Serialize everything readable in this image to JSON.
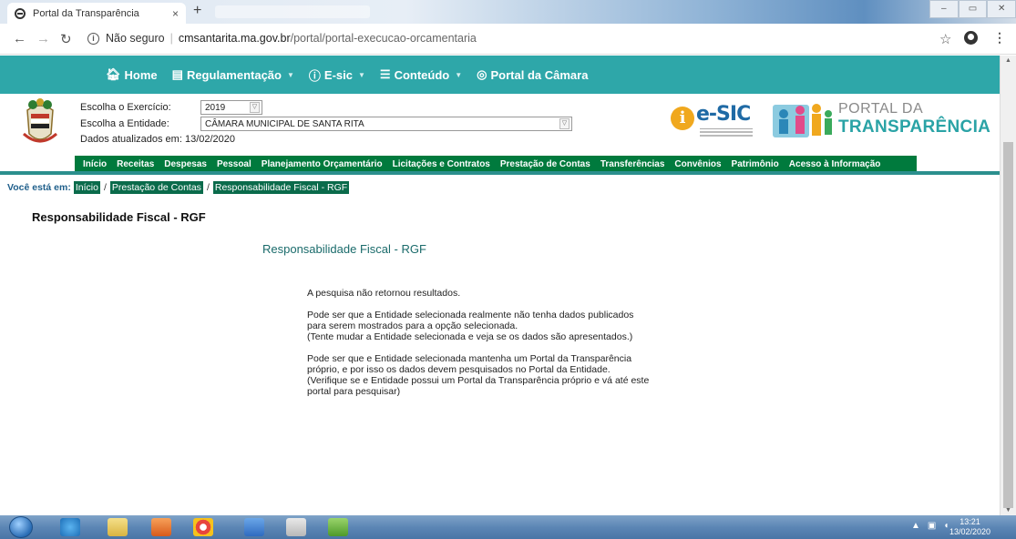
{
  "browser": {
    "tab_title": "Portal da Transparência",
    "tab_close": "×",
    "new_tab": "+",
    "security": "Não seguro",
    "url_host": "cmsantarita.ma.gov.br",
    "url_path": "/portal/portal-execucao-orcamentaria"
  },
  "topnav": {
    "items": [
      {
        "label": "Home"
      },
      {
        "label": "Regulamentação"
      },
      {
        "label": "E-sic"
      },
      {
        "label": "Conteúdo"
      },
      {
        "label": "Portal da Câmara"
      }
    ]
  },
  "filters": {
    "exercicio_label": "Escolha o Exercício:",
    "exercicio_value": "2019",
    "entidade_label": "Escolha a Entidade:",
    "entidade_value": "CÂMARA MUNICIPAL DE SANTA RITA",
    "updated": "Dados atualizados em: 13/02/2020"
  },
  "logos": {
    "esic": "e-SIC",
    "esic_i": "i",
    "portal_line1": "PORTAL DA",
    "portal_line2": "TRANSPARÊNCIA"
  },
  "menu": [
    "Início",
    "Receitas",
    "Despesas",
    "Pessoal",
    "Planejamento Orçamentário",
    "Licitações e Contratos",
    "Prestação de Contas",
    "Transferências",
    "Convênios",
    "Patrimônio",
    "Acesso à Informação"
  ],
  "breadcrumb": {
    "prefix": "Você está em:",
    "items": [
      "Início",
      "Prestação de Contas",
      "Responsabilidade Fiscal - RGF"
    ],
    "sep": "/"
  },
  "page": {
    "title": "Responsabilidade Fiscal - RGF",
    "subtitle": "Responsabilidade Fiscal - RGF",
    "msg1": "A pesquisa não retornou resultados.",
    "msg2": [
      "Pode ser que a Entidade selecionada realmente não tenha dados publicados",
      "para serem mostrados para a opção selecionada.",
      "(Tente mudar a Entidade selecionada e veja se os dados são apresentados.)"
    ],
    "msg3": [
      "Pode ser que e Entidade selecionada mantenha um Portal da Transparência",
      "próprio, e por isso os dados devem pesquisados no Portal da Entidade.",
      "(Verifique se e Entidade possui um Portal da Transparência próprio e vá até este",
      "portal para pesquisar)"
    ]
  },
  "taskbar": {
    "time": "13:21",
    "date": "13/02/2020"
  },
  "colors": {
    "topnav": "#2ea7a9",
    "menu": "#007a3d",
    "crumb": "#0a6b4b"
  }
}
